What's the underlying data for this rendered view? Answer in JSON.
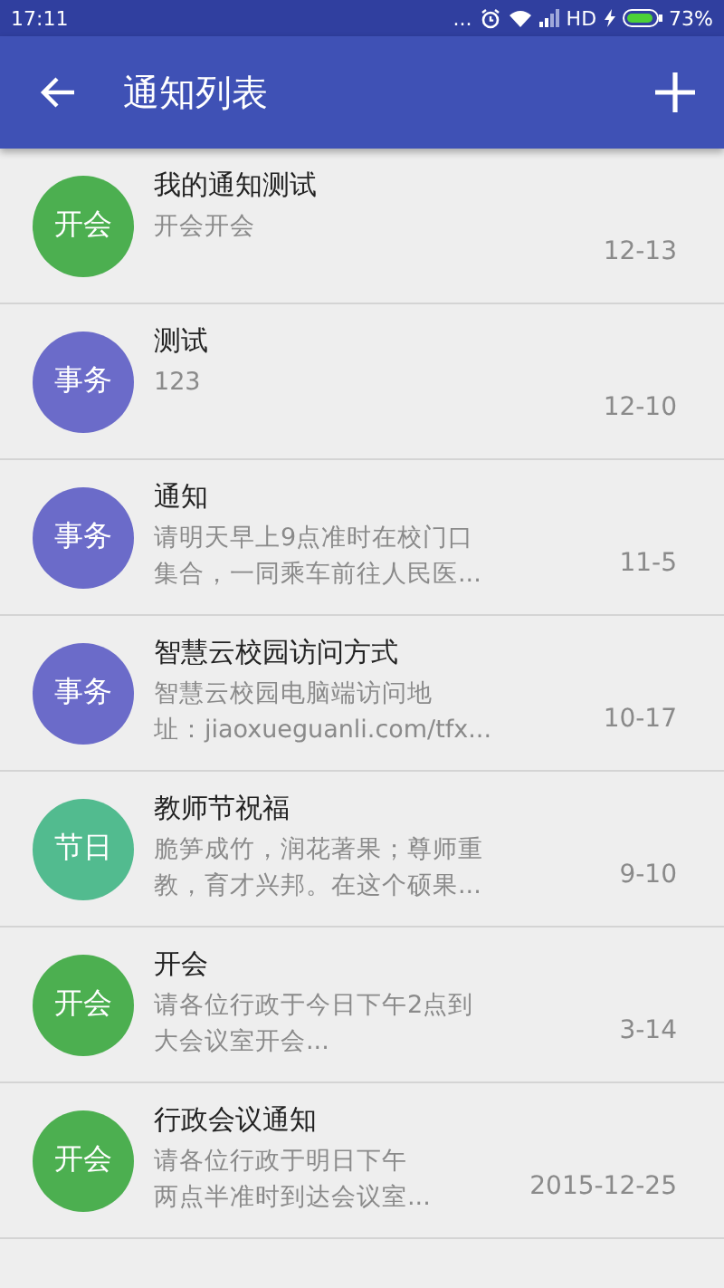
{
  "status_bar": {
    "time": "17:11",
    "more": "...",
    "network": "HD",
    "battery": "73%"
  },
  "app_bar": {
    "title": "通知列表"
  },
  "notices": [
    {
      "badge": "开会",
      "color": "#4caf50",
      "title": "我的通知测试",
      "preview": [
        "开会开会"
      ],
      "date": "12-13"
    },
    {
      "badge": "事务",
      "color": "#6b6bc9",
      "title": "测试",
      "preview": [
        "123"
      ],
      "date": "12-10"
    },
    {
      "badge": "事务",
      "color": "#6b6bc9",
      "title": "通知",
      "preview": [
        "请明天早上9点准时在校门口",
        "集合，一同乘车前往人民医..."
      ],
      "date": "11-5"
    },
    {
      "badge": "事务",
      "color": "#6b6bc9",
      "title": "智慧云校园访问方式",
      "preview": [
        "智慧云校园电脑端访问地",
        "址：jiaoxueguanli.com/tfx..."
      ],
      "date": "10-17"
    },
    {
      "badge": "节日",
      "color": "#52bb8f",
      "title": "教师节祝福",
      "preview": [
        "脆笋成竹，润花著果；尊师重",
        "教，育才兴邦。在这个硕果..."
      ],
      "date": "9-10"
    },
    {
      "badge": "开会",
      "color": "#4caf50",
      "title": "开会",
      "preview": [
        "请各位行政于今日下午2点到",
        "大会议室开会..."
      ],
      "date": "3-14"
    },
    {
      "badge": "开会",
      "color": "#4caf50",
      "title": "行政会议通知",
      "preview": [
        "请各位行政于明日下午",
        "两点半准时到达会议室..."
      ],
      "date": "2015-12-25"
    }
  ]
}
